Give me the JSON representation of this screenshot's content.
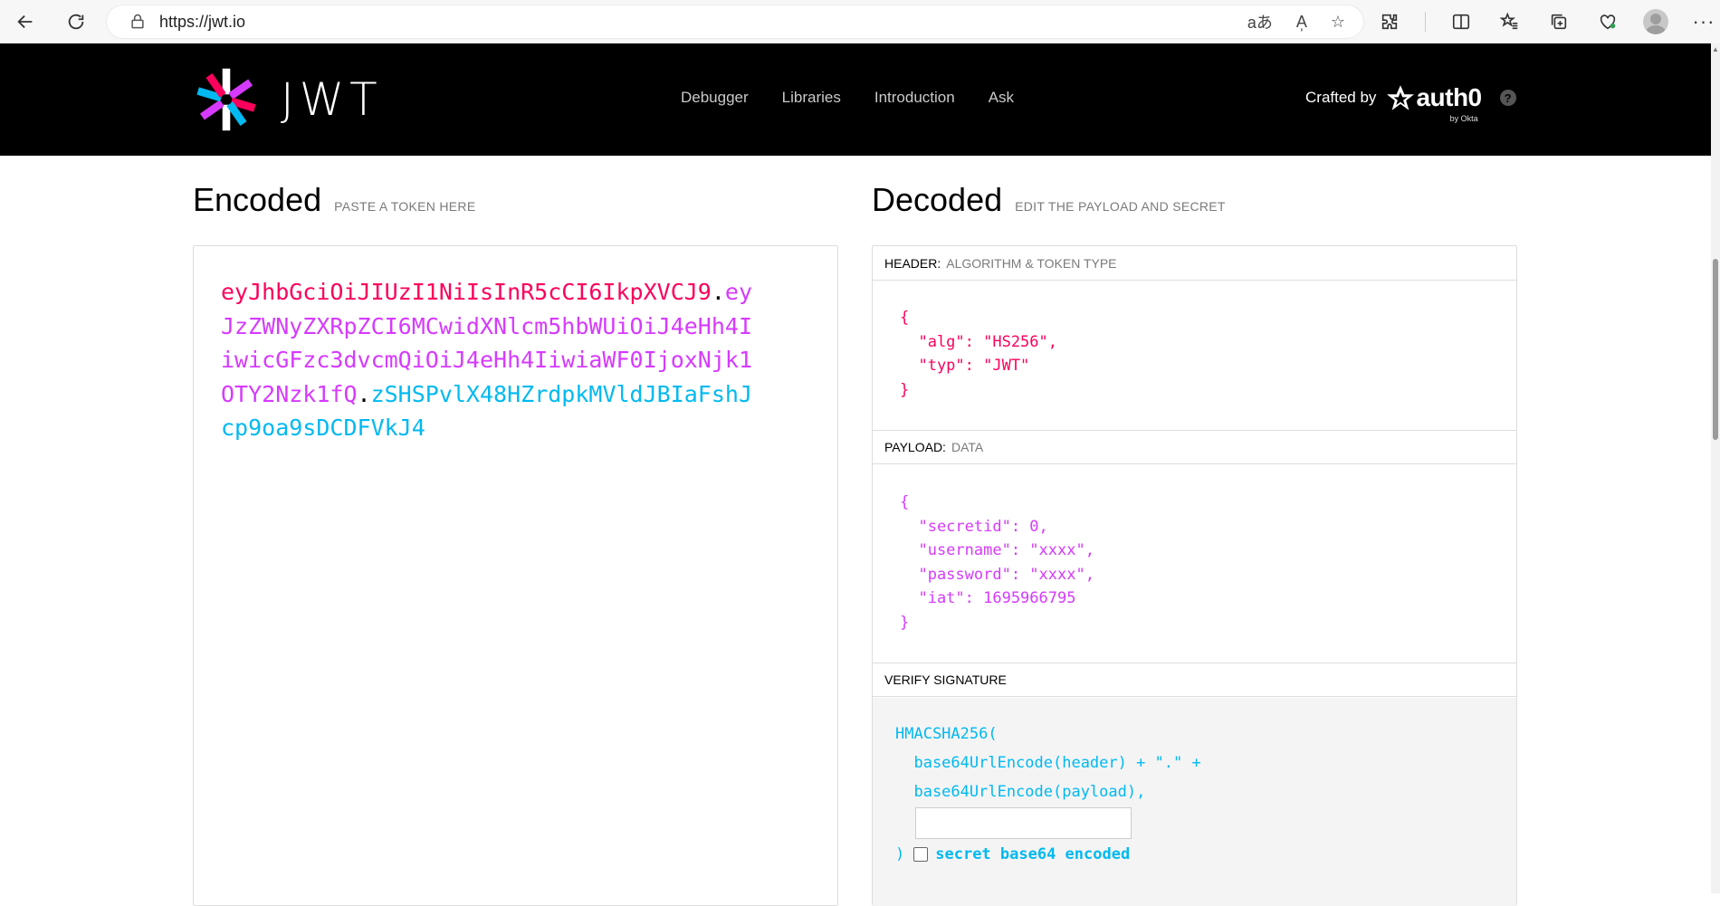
{
  "browser": {
    "url": "https://jwt.io",
    "url_actions": [
      "aあ",
      "A̩",
      "☆"
    ],
    "toolbar_icons": [
      "extensions-icon",
      "split-screen-icon",
      "favorites-icon",
      "collections-icon",
      "browser-essentials-icon"
    ]
  },
  "site": {
    "logo_text": "JWT",
    "nav": [
      "Debugger",
      "Libraries",
      "Introduction",
      "Ask"
    ],
    "crafted_by": "Crafted by",
    "auth0": "auth0",
    "auth0_sub": "by Okta",
    "help": "?"
  },
  "encoded": {
    "title": "Encoded",
    "subtitle": "PASTE A TOKEN HERE",
    "header_part": "eyJhbGciOiJIUzI1NiIsInR5cCI6IkpXVCJ9",
    "payload_part": "eyJzZWNyZXRpZCI6MCwidXNlcm5hbWUiOiJ4eHh4IiwicGFzc3dvcmQiOiJ4eHh4IiwiaWF0IjoxNjk1OTY2Nzk1fQ",
    "signature_part": "zSHSPvlX48HZrdpkMVldJBIaFshJcp9oa9sDCDFVkJ4",
    "dot": "."
  },
  "decoded": {
    "title": "Decoded",
    "subtitle": "EDIT THE PAYLOAD AND SECRET",
    "header_label": "HEADER:",
    "header_sub": "ALGORITHM & TOKEN TYPE",
    "header_json": "{\n  \"alg\": \"HS256\",\n  \"typ\": \"JWT\"\n}",
    "payload_label": "PAYLOAD:",
    "payload_sub": "DATA",
    "payload_json": "{\n  \"secretid\": 0,\n  \"username\": \"xxxx\",\n  \"password\": \"xxxx\",\n  \"iat\": 1695966795\n}",
    "verify_label": "VERIFY SIGNATURE",
    "verify_code": "HMACSHA256(\n  base64UrlEncode(header) + \".\" +\n  base64UrlEncode(payload),",
    "verify_close": ")",
    "secret_value": "",
    "secret_base64_label": "secret base64 encoded"
  },
  "colors": {
    "header": "#fb015b",
    "payload": "#d63aff",
    "signature": "#00b9f1"
  }
}
